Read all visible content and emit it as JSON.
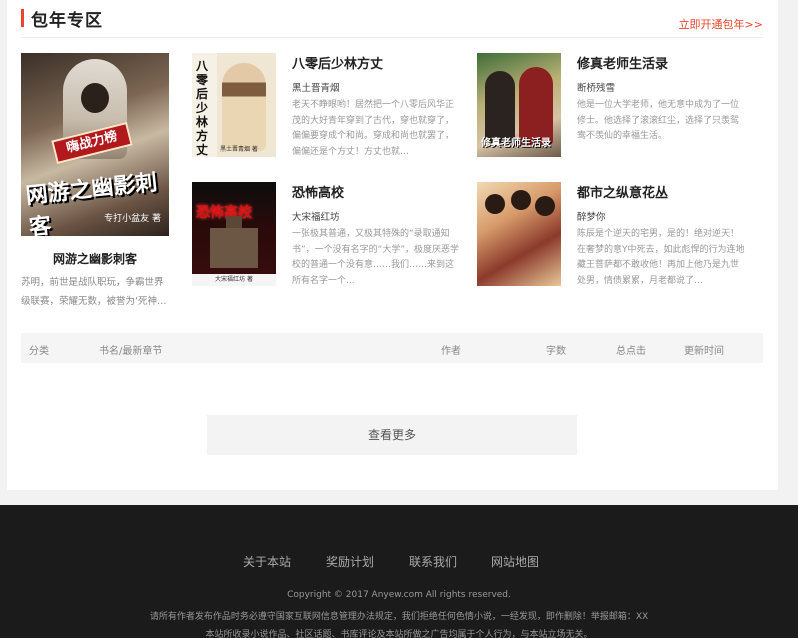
{
  "section": {
    "title": "包年专区",
    "more_link": "立即开通包年>>"
  },
  "featured": {
    "name": "网游之幽影刺客",
    "desc": "苏明，前世是战队职玩，争霸世界级联赛，荣耀无数，被誉为‘死神…",
    "cover_ribbon": "嗨战力榜",
    "cover_title": "网游之幽影刺客",
    "cover_author": "专打小盆友 著"
  },
  "books": [
    {
      "name": "八零后少林方丈",
      "author": "黑土晋青烟",
      "desc": "老天不睁眼哟！居然把一个八零后风华正茂的大好青年穿到了古代，穿也就穿了，偏偏要穿成个和尚。穿成和尚也就罢了，偏偏还是个方丈！方丈也就…",
      "cover_title": "八零后少林方丈",
      "cover_tag": "黑土晋青烟 著"
    },
    {
      "name": "修真老师生活录",
      "author": "断桥残雪",
      "desc": "他是一位大学老师，他无意中成为了一位修士。他选择了滚滚红尘，选择了只羡鸳鸯不羡仙的幸福生活。",
      "cover_title": "修真老师生活录"
    },
    {
      "name": "恐怖高校",
      "author": "大宋福红坊",
      "desc": "一张极其普通，又极其特殊的“录取通知书”，一个没有名字的“大学”，极度厌恶学校的普通一个没有意……我们……来到这所有名字一个...",
      "cover_title": "恐怖高校",
      "cover_tag": "大宋福红坊 著"
    },
    {
      "name": "都市之纵意花丛",
      "author": "醉梦你",
      "desc": "陈辰是个逆天的宅男，是的！绝对逆天！在奢梦的意Y中死去，如此彪悍的行为连地藏王菩萨都不敢收他！再加上他乃是九世处男，情债累累，月老都说了…"
    }
  ],
  "table": {
    "headers": [
      "分类",
      "书名/最新章节",
      "作者",
      "字数",
      "总点击",
      "更新时间"
    ]
  },
  "more_button": "查看更多",
  "footer": {
    "nav": [
      "关于本站",
      "奖励计划",
      "联系我们",
      "网站地图"
    ],
    "copyright": "Copyright © 2017 Anyew.com All rights reserved.",
    "notice": "请所有作者发布作品时务必遵守国家互联网信息管理办法规定，我们拒绝任何色情小说，一经发现，即作删除！举报邮箱：XX",
    "disclaimer": "本站所收录小说作品、社区话题、书库评论及本站所做之广告均属于个人行为，与本站立场无关。"
  }
}
